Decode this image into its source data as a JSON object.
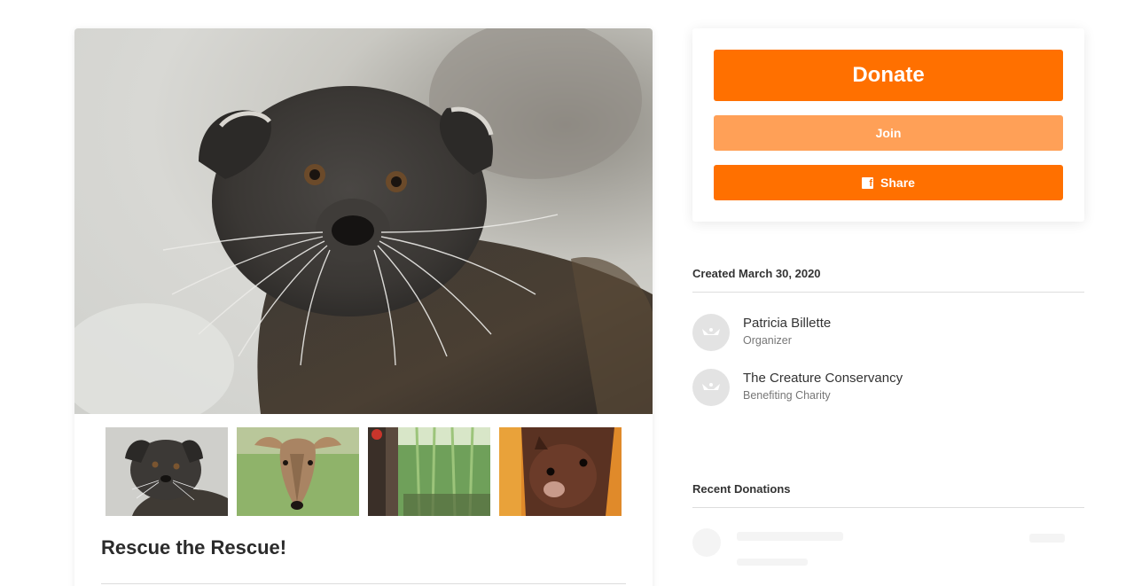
{
  "campaign": {
    "title": "Rescue the Rescue!",
    "thumbnails": [
      {
        "icon": "binturong-photo"
      },
      {
        "icon": "muntjac-deer-photo"
      },
      {
        "icon": "bamboo-enclosure-photo"
      },
      {
        "icon": "fruit-bat-photo"
      }
    ]
  },
  "actions": {
    "donate_label": "Donate",
    "join_label": "Join",
    "share_label": "Share",
    "share_icon": "facebook-icon"
  },
  "details": {
    "created": "Created March 30, 2020",
    "people": [
      {
        "name": "Patricia Billette",
        "role": "Organizer"
      },
      {
        "name": "The Creature Conservancy",
        "role": "Benefiting Charity"
      }
    ]
  },
  "donations": {
    "heading": "Recent Donations"
  },
  "colors": {
    "accent": "#ff7000",
    "accent_light": "#ffa057"
  }
}
